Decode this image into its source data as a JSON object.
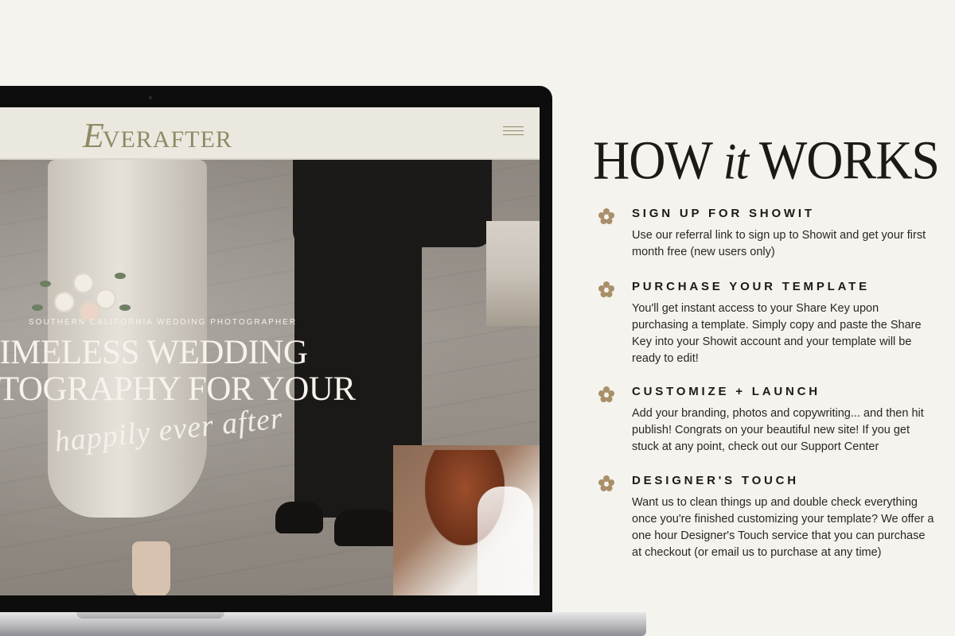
{
  "site": {
    "logo": "EVERAFTER",
    "logo_initial": "E",
    "logo_rest": "VERAFTER",
    "hero_subtitle": "SOUTHERN CALIFORNIA WEDDING PHOTOGRAPHER",
    "hero_title_line1": "TIMELESS WEDDING",
    "hero_title_line2": "PHOTOGRAPHY FOR YOUR",
    "hero_script": "happily ever after"
  },
  "how_it_works": {
    "title_part1": "HOW ",
    "title_italic": "it",
    "title_part2": " WORKS",
    "steps": [
      {
        "heading": "SIGN UP FOR SHOWIT",
        "body": "Use our referral link to sign up to Showit and get your first month free (new users only)"
      },
      {
        "heading": "PURCHASE YOUR TEMPLATE",
        "body": "You'll get instant access to your Share Key upon purchasing a template. Simply copy and paste the Share Key into your Showit account and your template will be ready to edit!"
      },
      {
        "heading": "CUSTOMIZE + LAUNCH",
        "body": "Add your branding, photos and copywriting... and then hit publish! Congrats on your beautiful new site! If you get stuck at any point, check out our Support Center"
      },
      {
        "heading": "DESIGNER'S TOUCH",
        "body": "Want us to clean things up and double check everything once you're finished customizing your template? We offer a one hour Designer's Touch service that you can purchase at checkout (or email us to purchase at any time)"
      }
    ]
  },
  "colors": {
    "background": "#f5f3ee",
    "accent": "#a88f6a",
    "logo": "#8f8a63",
    "text": "#1c1a17"
  },
  "icons": {
    "step_bullet": "flower-icon",
    "menu": "hamburger-menu-icon"
  }
}
